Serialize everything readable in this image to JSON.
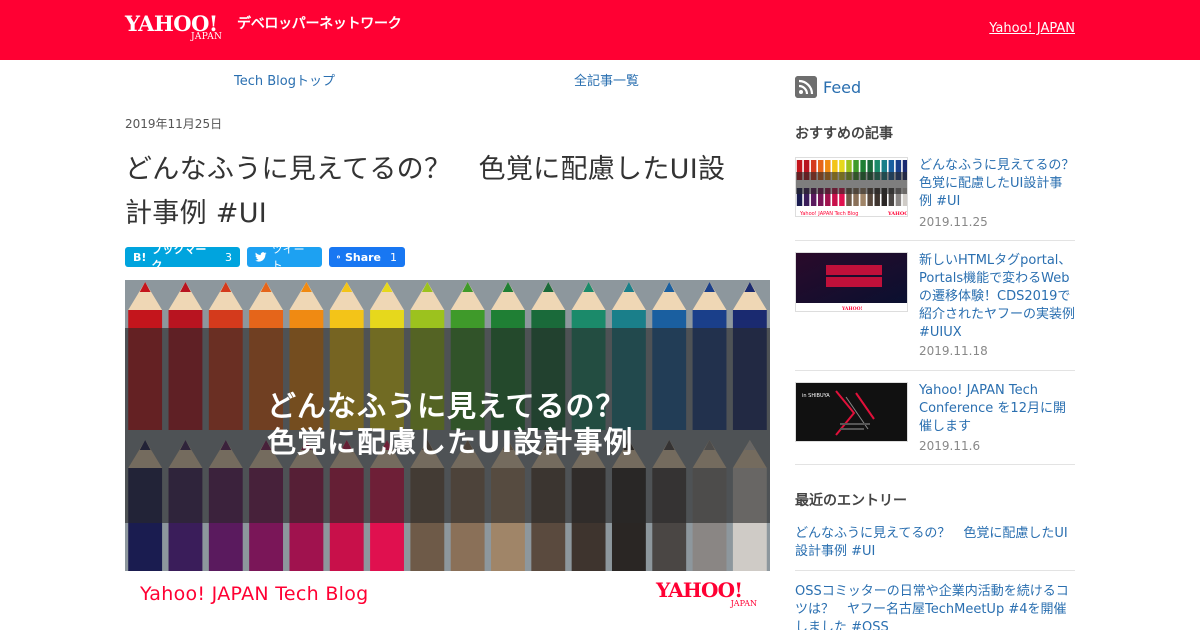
{
  "header": {
    "logo_word": "YAHOO!",
    "logo_sub": "JAPAN",
    "site_name": "デベロッパーネットワーク",
    "right_link": "Yahoo! JAPAN",
    "bg_color": "#ff0033"
  },
  "nav": {
    "items": [
      {
        "label": "Tech Blogトップ"
      },
      {
        "label": "全記事一覧"
      }
    ]
  },
  "article": {
    "date": "2019年11月25日",
    "title_line1": "どんなふうに見えてるの？　色覚に配慮したUI設",
    "title_line2": "計事例 #UI",
    "share": {
      "hatena_label": "ブックマーク",
      "hatena_count": "3",
      "tweet_label": "ツイート",
      "fb_label": "Share",
      "fb_count": "1"
    },
    "hero": {
      "heading_line1": "どんなふうに見えてるの？",
      "heading_line2": "色覚に配慮したUI設計事例",
      "blog_name": "Yahoo! JAPAN Tech Blog",
      "logo_word": "YAHOO!",
      "logo_sub": "JAPAN"
    }
  },
  "sidebar": {
    "feed_label": "Feed",
    "recommended_title": "おすすめの記事",
    "recommended": [
      {
        "title": "どんなふうに見えてるの？　色覚に配慮したUI設計事例 #UI",
        "date": "2019.11.25",
        "icon": "colored-pencils-thumbnail"
      },
      {
        "title": "新しいHTMLタグportal、Portals機能で変わるWebの遷移体験！CDS2019で紹介されたヤフーの実装例 #UIUX",
        "date": "2019.11.18",
        "icon": "portals-slide-thumbnail"
      },
      {
        "title": "Yahoo! JAPAN Tech Conference を12月に開催します",
        "date": "2019.11.6",
        "icon": "tech-conference-thumbnail"
      }
    ],
    "recent_title": "最近のエントリー",
    "recent": [
      {
        "title": "どんなふうに見えてるの？　色覚に配慮したUI設計事例 #UI"
      },
      {
        "title": "OSSコミッターの日常や企業内活動を続けるコツは？　ヤフー名古屋TechMeetUp #4を開催しました #OSS"
      }
    ]
  }
}
